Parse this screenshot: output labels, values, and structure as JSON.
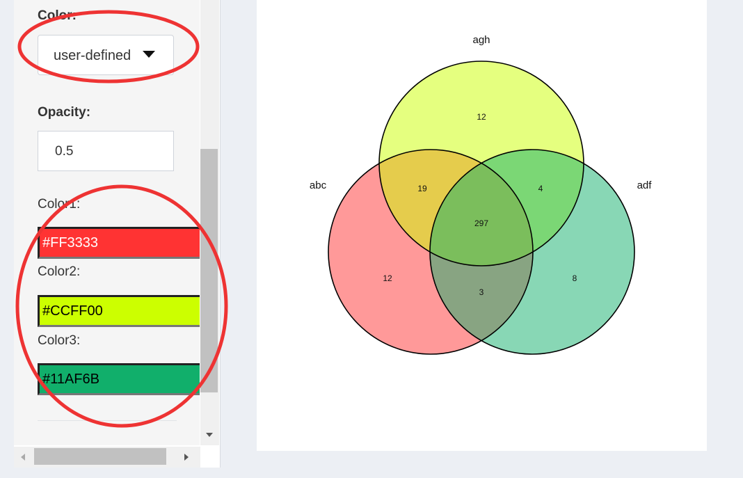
{
  "sidebar": {
    "color_label": "Color:",
    "color_select_value": "user-defined",
    "opacity_label": "Opacity:",
    "opacity_value": "0.5",
    "colors": [
      {
        "label": "Color1:",
        "value": "#FF3333",
        "text_color": "#ffffff"
      },
      {
        "label": "Color2:",
        "value": "#CCFF00",
        "text_color": "#000000"
      },
      {
        "label": "Color3:",
        "value": "#11AF6B",
        "text_color": "#000000"
      }
    ]
  },
  "chart_data": {
    "type": "venn",
    "sets": [
      {
        "name": "abc",
        "color": "#FF3333"
      },
      {
        "name": "agh",
        "color": "#CCFF00"
      },
      {
        "name": "adf",
        "color": "#11AF6B"
      }
    ],
    "opacity": 0.5,
    "regions": {
      "abc_only": "12",
      "agh_only": "12",
      "adf_only": "8",
      "abc_agh": "19",
      "agh_adf": "4",
      "abc_adf": "3",
      "abc_agh_adf": "297"
    }
  },
  "annotation_color": "#ee3333"
}
